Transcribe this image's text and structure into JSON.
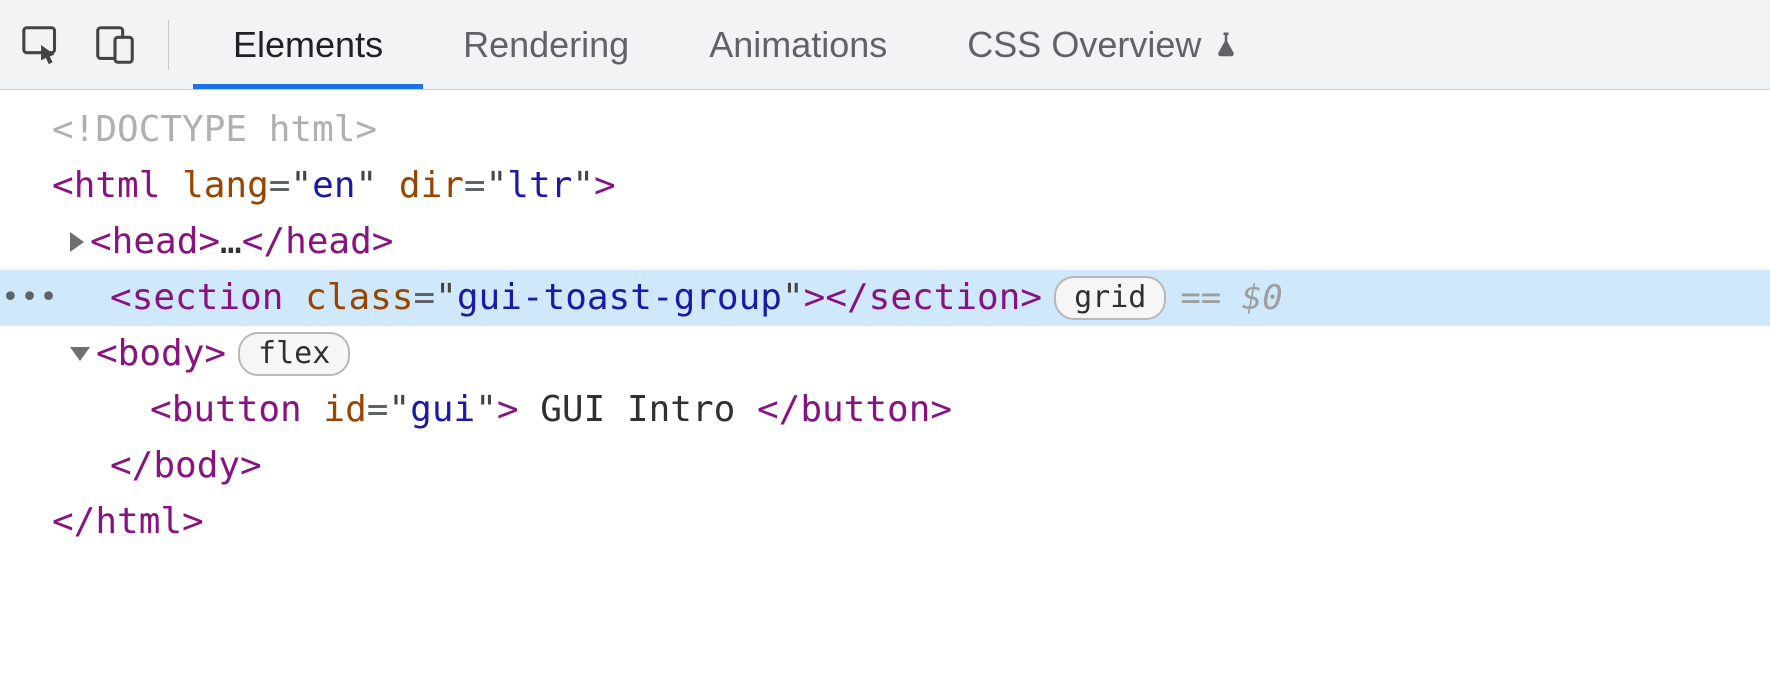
{
  "toolbar": {
    "tabs": {
      "elements": "Elements",
      "rendering": "Rendering",
      "animations": "Animations",
      "css_overview": "CSS Overview"
    }
  },
  "dom": {
    "doctype": "<!DOCTYPE html>",
    "html_open_prefix": "<",
    "html_tag": "html",
    "lang_attr": "lang",
    "lang_val": "en",
    "dir_attr": "dir",
    "dir_val": "ltr",
    "html_open_suffix": ">",
    "head_open": "<head>",
    "head_ellipsis": "…",
    "head_close": "</head>",
    "section_tag": "section",
    "class_attr": "class",
    "section_class_val": "gui-toast-group",
    "section_close": "</section>",
    "section_pill": "grid",
    "section_suffix_eq": "==",
    "section_suffix_ref": "$0",
    "body_open": "<body>",
    "body_pill": "flex",
    "button_tag": "button",
    "id_attr": "id",
    "button_id_val": "gui",
    "button_text": " GUI Intro ",
    "button_close": "</button>",
    "body_close": "</body>",
    "html_close": "</html>",
    "gutter_dots": "•••"
  }
}
